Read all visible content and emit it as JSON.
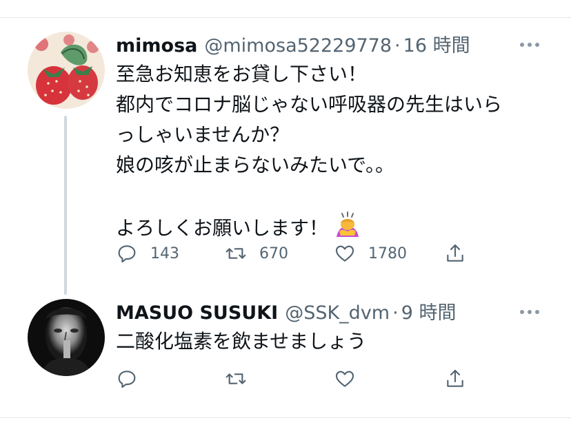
{
  "tweets": [
    {
      "name": "mimosa",
      "handle": "@mimosa52229778",
      "time": "16 時間",
      "lines": [
        "至急お知恵をお貸し下さい！",
        "都内でコロナ脳じゃない呼吸器の先生はいら",
        "っしゃいませんか？",
        "娘の咳が止まらないみたいで。。",
        "",
        "よろしくお願いします！"
      ],
      "emoji": "person-bowing-emoji",
      "replies": "143",
      "retweets": "670",
      "likes": "1780"
    },
    {
      "name": "MASUO SUSUKI",
      "handle": "@SSK_dvm",
      "time": "9 時間",
      "lines": [
        "二酸化塩素を飲ませましょう"
      ],
      "replies": "",
      "retweets": "",
      "likes": ""
    }
  ],
  "icons": {
    "reply": "reply-icon",
    "retweet": "retweet-icon",
    "like": "heart-icon",
    "share": "share-icon",
    "more": "more-icon"
  },
  "colors": {
    "text": "#0f1419",
    "secondary": "#536471",
    "thread_line": "#cfd9de",
    "icon": "#536471"
  }
}
